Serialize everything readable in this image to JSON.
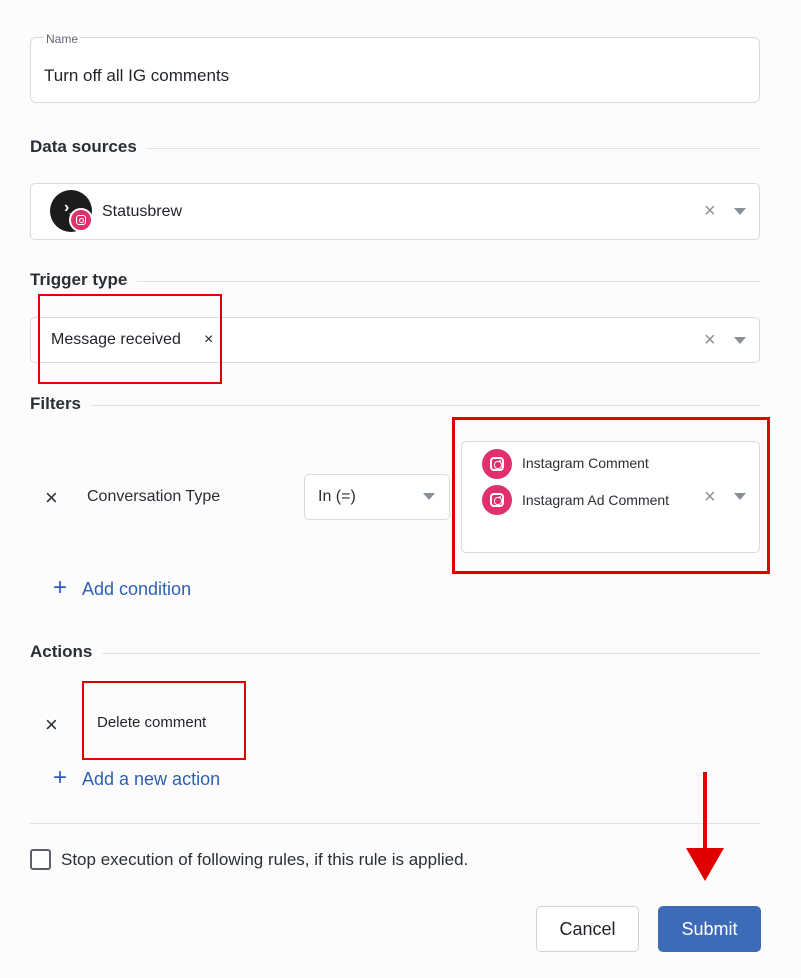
{
  "name_field": {
    "label": "Name",
    "value": "Turn off all IG comments"
  },
  "data_sources": {
    "title": "Data sources",
    "selected": "Statusbrew",
    "avatar_icon": "terminal-prompt-icon",
    "badge_icon": "instagram-icon"
  },
  "trigger_type": {
    "title": "Trigger type",
    "selected_tag": "Message received",
    "tag_remove": "×"
  },
  "filters": {
    "title": "Filters",
    "condition": {
      "remove": "×",
      "field": "Conversation Type",
      "operator": "In (=)",
      "values": [
        "Instagram Comment",
        "Instagram Ad Comment"
      ]
    },
    "add_condition": "Add condition"
  },
  "actions": {
    "title": "Actions",
    "items": [
      {
        "remove": "×",
        "label": "Delete comment"
      }
    ],
    "add_action": "Add a new action"
  },
  "stop_execution": {
    "label": "Stop execution of following rules, if this rule is applied.",
    "checked": false
  },
  "buttons": {
    "cancel": "Cancel",
    "submit": "Submit"
  },
  "colors": {
    "accent": "#3d6bb8",
    "link": "#2f5fb3",
    "instagram": "#e1306c",
    "highlight": "#e10000"
  },
  "glyphs": {
    "clear": "×",
    "plus": "+"
  }
}
